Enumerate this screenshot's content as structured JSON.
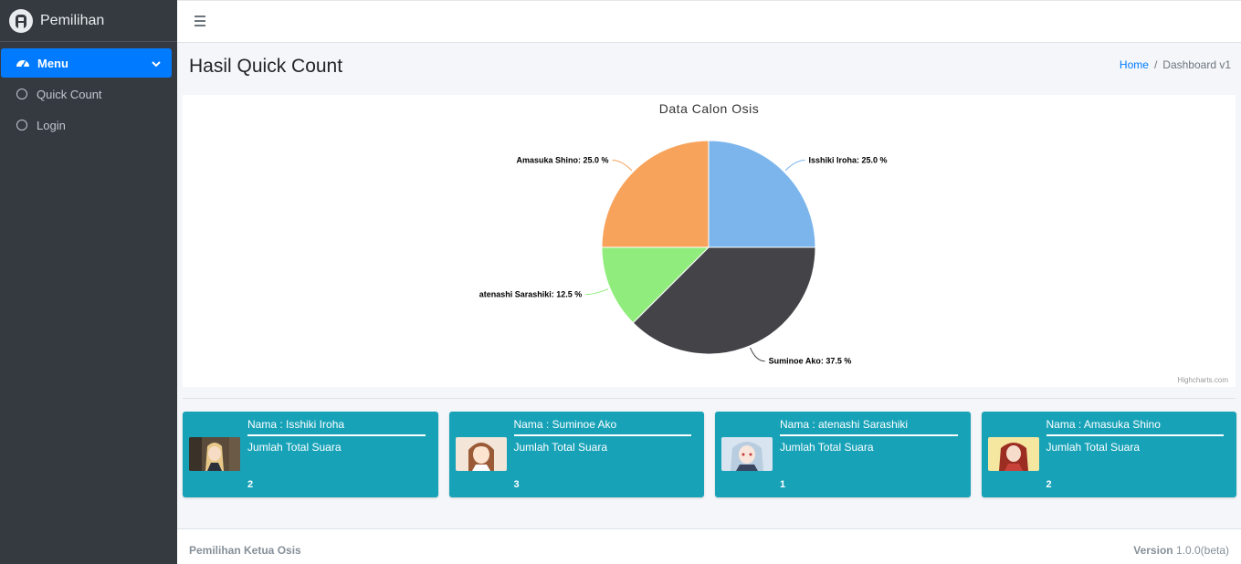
{
  "brand": {
    "name": "Pemilihan"
  },
  "sidebar": {
    "items": [
      {
        "label": "Menu",
        "icon": "tachometer-icon",
        "active": true
      },
      {
        "label": "Quick Count",
        "icon": "circle-icon"
      },
      {
        "label": "Login",
        "icon": "circle-icon"
      }
    ]
  },
  "header": {
    "title": "Hasil Quick Count",
    "breadcrumb": {
      "home": "Home",
      "separator": "/",
      "current": "Dashboard v1"
    }
  },
  "chart_data": {
    "type": "pie",
    "title": "Data Calon Osis",
    "credit": "Highcharts.com",
    "slices": [
      {
        "name": "Isshiki Iroha",
        "value": 25.0,
        "color": "#7cb5ec",
        "label": "Isshiki Iroha: 25.0 %"
      },
      {
        "name": "Suminoe Ako",
        "value": 37.5,
        "color": "#434348",
        "label": "Suminoe Ako: 37.5 %"
      },
      {
        "name": "atenashi Sarashiki",
        "value": 12.5,
        "color": "#90ed7d",
        "label": "atenashi Sarashiki: 12.5 %"
      },
      {
        "name": "Amasuka Shino",
        "value": 25.0,
        "color": "#f7a35c",
        "label": "Amasuka Shino: 25.0 %"
      }
    ]
  },
  "candidates": [
    {
      "nama": "Nama : Isshiki Iroha",
      "label": "Jumlah Total Suara",
      "count": "2"
    },
    {
      "nama": "Nama : Suminoe Ako",
      "label": "Jumlah Total Suara",
      "count": "3"
    },
    {
      "nama": "Nama : atenashi Sarashiki",
      "label": "Jumlah Total Suara",
      "count": "1"
    },
    {
      "nama": "Nama : Amasuka Shino",
      "label": "Jumlah Total Suara",
      "count": "2"
    }
  ],
  "footer": {
    "left": "Pemilihan Ketua Osis",
    "version_label": "Version",
    "version_value": "1.0.0(beta)"
  },
  "colors": {
    "sidebar": "#343a40",
    "accent": "#007bff",
    "info_box": "#17a2b8"
  }
}
